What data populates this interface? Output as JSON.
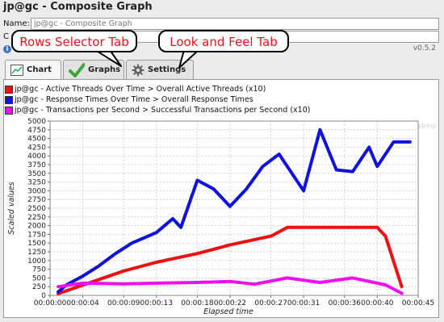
{
  "window": {
    "title": "jp@gc - Composite Graph"
  },
  "name_row": {
    "label": "Name:",
    "value": "jp@gc - Composite Graph"
  },
  "comments_row": {
    "label": "C"
  },
  "version": "v0.5.2",
  "callouts": {
    "rows_selector": "Rows Selector Tab",
    "look_and_feel": "Look and Feel  Tab"
  },
  "tabs": [
    {
      "label": "Chart",
      "icon": "chart-icon"
    },
    {
      "label": "Graphs",
      "icon": "checkmark-icon"
    },
    {
      "label": "Settings",
      "icon": "gear-icon"
    }
  ],
  "watermark": "http://apx.kg/jp4/gc",
  "colors": {
    "red": "#ee1111",
    "blue": "#1111dd",
    "magenta": "#ee11ee",
    "callout_text": "#e8141b"
  },
  "chart_data": {
    "type": "line",
    "xlabel": "Elapsed time",
    "ylabel": "Scaled values",
    "ylim": [
      0,
      5000
    ],
    "yticks": [
      "0",
      "250",
      "500",
      "750",
      "1000",
      "1250",
      "1500",
      "1750",
      "2000",
      "2250",
      "2500",
      "2750",
      "3000",
      "3250",
      "3500",
      "3750",
      "4000",
      "4250",
      "4500",
      "4750",
      "5000"
    ],
    "xticks": [
      "00:00:00",
      "00:00:04",
      "00:00:09",
      "00:00:13",
      "00:00:18",
      "00:00:22",
      "00:00:27",
      "00:00:31",
      "00:00:36",
      "00:00:40",
      "00:00:45"
    ],
    "grid": true,
    "legend_position": "top",
    "series": [
      {
        "name": "jp@gc - Active Threads Over Time > Overall Active Threads (x10)",
        "color": "#ee1111",
        "x": [
          "00:00:01",
          "00:00:09",
          "00:00:13",
          "00:00:18",
          "00:00:22",
          "00:00:27",
          "00:00:29",
          "00:00:38",
          "00:00:40",
          "00:00:41",
          "00:00:43"
        ],
        "y": [
          50,
          700,
          950,
          1200,
          1450,
          1700,
          1950,
          1950,
          1950,
          1700,
          250
        ]
      },
      {
        "name": "jp@gc - Response Times Over Time > Overall Response Times",
        "color": "#1111dd",
        "x": [
          "00:00:01",
          "00:00:02",
          "00:00:04",
          "00:00:06",
          "00:00:08",
          "00:00:10",
          "00:00:11",
          "00:00:13",
          "00:00:15",
          "00:00:16",
          "00:00:18",
          "00:00:20",
          "00:00:22",
          "00:00:24",
          "00:00:26",
          "00:00:28",
          "00:00:31",
          "00:00:33",
          "00:00:35",
          "00:00:37",
          "00:00:39",
          "00:00:40",
          "00:00:42",
          "00:00:44"
        ],
        "y": [
          100,
          300,
          550,
          850,
          1200,
          1500,
          1600,
          1800,
          2200,
          1950,
          3300,
          3050,
          2550,
          3050,
          3700,
          4050,
          3000,
          4750,
          3600,
          3550,
          4250,
          3700,
          4400,
          4400
        ]
      },
      {
        "name": "jp@gc - Transactions per Second > Successful Transactions per Second (x10)",
        "color": "#ee11ee",
        "x": [
          "00:00:01",
          "00:00:04",
          "00:00:09",
          "00:00:13",
          "00:00:18",
          "00:00:22",
          "00:00:25",
          "00:00:29",
          "00:00:33",
          "00:00:37",
          "00:00:41",
          "00:00:43"
        ],
        "y": [
          250,
          350,
          330,
          350,
          370,
          400,
          320,
          500,
          370,
          500,
          300,
          60
        ]
      }
    ]
  }
}
